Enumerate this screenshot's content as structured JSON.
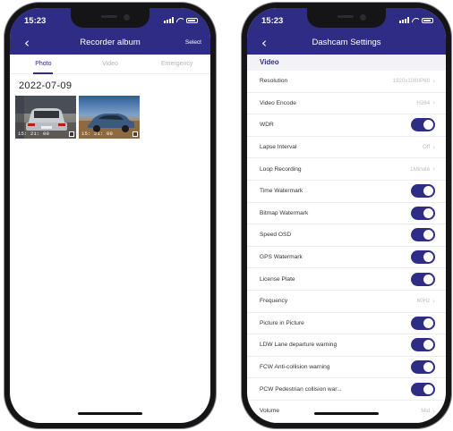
{
  "album": {
    "status_time": "15:23",
    "title": "Recorder album",
    "select_label": "Select",
    "back_glyph": "‹",
    "tabs": [
      {
        "label": "Photo",
        "active": true
      },
      {
        "label": "Video",
        "active": false
      },
      {
        "label": "Emergency",
        "active": false
      }
    ],
    "date": "2022-07-09",
    "thumbnails": [
      {
        "time": "15: 21: 00",
        "icon": "file-icon"
      },
      {
        "time": "15: 21: 00",
        "icon": "file-icon"
      }
    ]
  },
  "settings": {
    "status_time": "15:23",
    "title": "Dashcam Settings",
    "back_glyph": "‹",
    "section": "Video",
    "rows": [
      {
        "label": "Resolution",
        "value": "1920x1080P60",
        "control": "chevron"
      },
      {
        "label": "Video Encode",
        "value": "H264",
        "control": "chevron"
      },
      {
        "label": "WDR",
        "value": "",
        "control": "toggle",
        "on": true
      },
      {
        "label": "Lapse Interval",
        "value": "Off",
        "control": "chevron"
      },
      {
        "label": "Loop Recording",
        "value": "1Minute",
        "control": "chevron"
      },
      {
        "label": "Time Watermark",
        "value": "",
        "control": "toggle",
        "on": true
      },
      {
        "label": "Bitmap Watermark",
        "value": "",
        "control": "toggle",
        "on": true
      },
      {
        "label": "Speed OSD",
        "value": "",
        "control": "toggle",
        "on": true
      },
      {
        "label": "GPS Watermark",
        "value": "",
        "control": "toggle",
        "on": true
      },
      {
        "label": "License Plate",
        "value": "",
        "control": "toggle",
        "on": true
      },
      {
        "label": "Frequency",
        "value": "60Hz",
        "control": "chevron"
      },
      {
        "label": "Picture in Picture",
        "value": "",
        "control": "toggle",
        "on": true
      },
      {
        "label": "LDW Lane departure warning",
        "value": "",
        "control": "toggle",
        "on": true
      },
      {
        "label": "FCW Anti-collision warning",
        "value": "",
        "control": "toggle",
        "on": true
      },
      {
        "label": "PCW Pedestrian collision war...",
        "value": "",
        "control": "toggle",
        "on": true
      },
      {
        "label": "Volume",
        "value": "Mid",
        "control": "chevron"
      }
    ]
  },
  "colors": {
    "brand": "#2e2c84",
    "section_bg": "#f3f3f7",
    "muted_text": "#bdbdbd"
  }
}
